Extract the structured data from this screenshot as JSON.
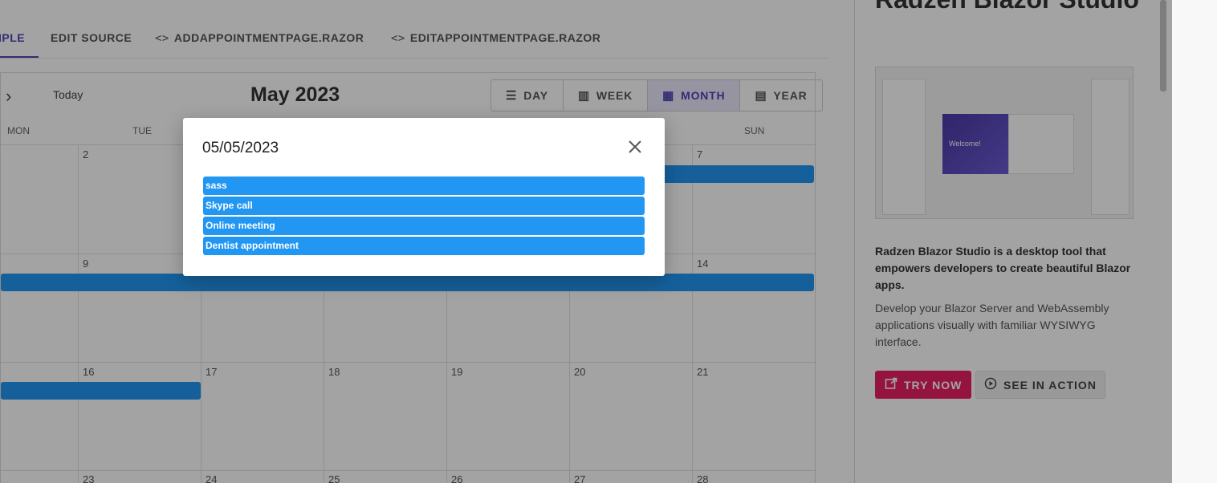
{
  "tabs": {
    "example_label": "IPLE",
    "edit_source_label": "EDIT SOURCE",
    "add_page_label": "ADDAPPOINTMENTPAGE.RAZOR",
    "edit_page_label": "EDITAPPOINTMENTPAGE.RAZOR",
    "code_icon": "<>"
  },
  "scheduler": {
    "next_icon": "›",
    "today_label": "Today",
    "title": "May 2023",
    "views": [
      {
        "label": "DAY",
        "icon": "☰"
      },
      {
        "label": "WEEK",
        "icon": "▥"
      },
      {
        "label": "MONTH",
        "icon": "▦"
      },
      {
        "label": "YEAR",
        "icon": "▤"
      }
    ],
    "weekdays": [
      "MON",
      "TUE",
      "SUN"
    ],
    "dates": [
      "2",
      "7",
      "9",
      "14",
      "16",
      "17",
      "18",
      "19",
      "20",
      "21",
      "23",
      "24",
      "25",
      "26",
      "27",
      "28"
    ]
  },
  "sidebar": {
    "title": "Radzen Blazor Studio",
    "bold_text": "Radzen Blazor Studio is a desktop tool that empowers developers to create beautiful Blazor apps.",
    "text": "Develop your Blazor Server and WebAssembly applications visually with familiar WYSIWYG interface.",
    "try_label": "TRY NOW",
    "see_label": "SEE IN ACTION",
    "screenshot_welcome": "Welcome!"
  },
  "dialog": {
    "title": "05/05/2023",
    "appointments": [
      "sass",
      "Skype call",
      "Online meeting",
      "Dentist appointment"
    ]
  },
  "colors": {
    "accent": "#4f46b8",
    "event": "#2196f3",
    "try_button": "#e91e63"
  }
}
